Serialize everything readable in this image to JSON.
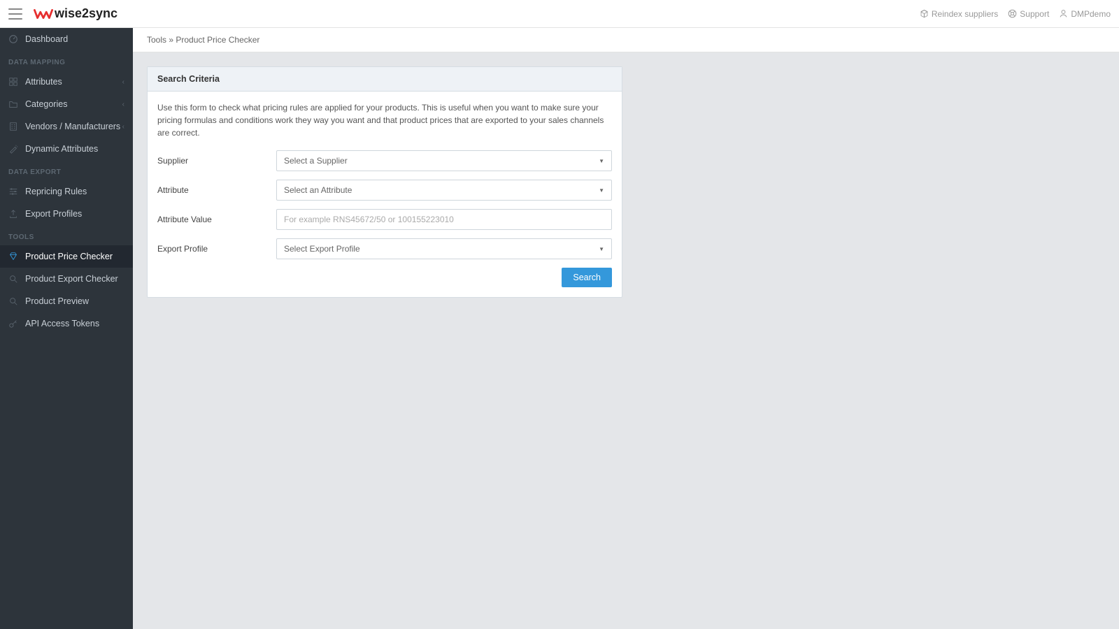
{
  "app": {
    "name": "wise2sync"
  },
  "header": {
    "reindex": "Reindex suppliers",
    "support": "Support",
    "user": "DMPdemo"
  },
  "sidebar": {
    "items": [
      {
        "label": "Dashboard"
      }
    ],
    "group_mapping": "DATA MAPPING",
    "mapping_items": [
      {
        "label": "Attributes",
        "expandable": true
      },
      {
        "label": "Categories",
        "expandable": true
      },
      {
        "label": "Vendors / Manufacturers",
        "expandable": true
      },
      {
        "label": "Dynamic Attributes"
      }
    ],
    "group_export": "DATA EXPORT",
    "export_items": [
      {
        "label": "Repricing Rules"
      },
      {
        "label": "Export Profiles"
      }
    ],
    "group_tools": "TOOLS",
    "tools_items": [
      {
        "label": "Product Price Checker",
        "active": true
      },
      {
        "label": "Product Export Checker"
      },
      {
        "label": "Product Preview"
      },
      {
        "label": "API Access Tokens"
      }
    ]
  },
  "breadcrumb": {
    "parent": "Tools",
    "sep": " » ",
    "current": "Product Price Checker"
  },
  "panel": {
    "title": "Search Criteria",
    "description": "Use this form to check what pricing rules are applied for your products. This is useful when you want to make sure your pricing formulas and conditions work they way you want and that product prices that are exported to your sales channels are correct.",
    "fields": {
      "supplier": {
        "label": "Supplier",
        "placeholder": "Select a Supplier"
      },
      "attribute": {
        "label": "Attribute",
        "placeholder": "Select an Attribute"
      },
      "attr_value": {
        "label": "Attribute Value",
        "placeholder": "For example RNS45672/50 or 100155223010"
      },
      "export_profile": {
        "label": "Export Profile",
        "placeholder": "Select Export Profile"
      }
    },
    "search_button": "Search"
  }
}
